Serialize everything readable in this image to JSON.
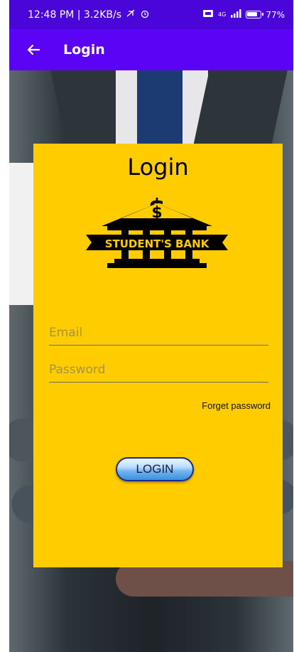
{
  "status_bar": {
    "time_and_speed": "12:48 PM | 3.2KB/s",
    "network_label": "4G",
    "battery": "77"
  },
  "app_bar": {
    "title": "Login",
    "back_icon": "arrow-left-icon"
  },
  "login_card": {
    "title": "Login",
    "logo_text": "STUDENT'S BANK",
    "logo_icon": "bank-dollar-icon",
    "email_placeholder": "Email",
    "email_value": "",
    "password_placeholder": "Password",
    "password_value": "",
    "forget_password_label": "Forget password",
    "login_button_label": "LOGIN"
  },
  "colors": {
    "status_bar": "#4a06d9",
    "app_bar": "#5b03f5",
    "card": "#ffcc00",
    "button_blue": "#6fb3ef"
  }
}
